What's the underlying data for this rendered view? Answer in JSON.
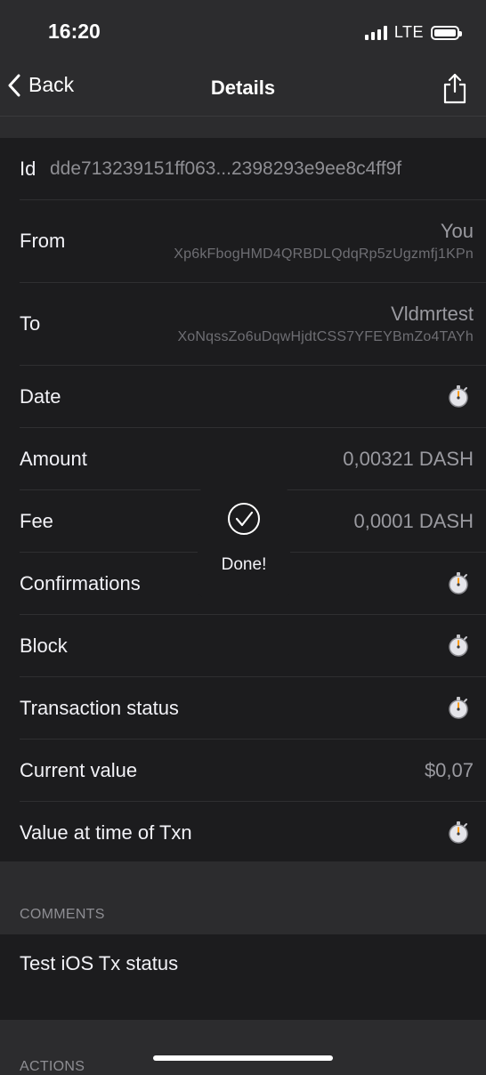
{
  "status_bar": {
    "time": "16:20",
    "network": "LTE"
  },
  "nav": {
    "back_label": "Back",
    "title": "Details"
  },
  "details": {
    "id_label": "Id",
    "id_value": "dde713239151ff063...2398293e9ee8c4ff9f",
    "from_label": "From",
    "from_name": "You",
    "from_address": "Xp6kFbogHMD4QRBDLQdqRp5zUgzmfj1KPn",
    "to_label": "To",
    "to_name": "Vldmrtest",
    "to_address": "XoNqssZo6uDqwHjdtCSS7YFEYBmZo4TAYh",
    "date_label": "Date",
    "amount_label": "Amount",
    "amount_value": "0,00321 DASH",
    "fee_label": "Fee",
    "fee_value": "0,0001 DASH",
    "confirmations_label": "Confirmations",
    "block_label": "Block",
    "tx_status_label": "Transaction status",
    "current_value_label": "Current value",
    "current_value": "$0,07",
    "value_at_time_label": "Value at time of Txn"
  },
  "comments": {
    "header": "COMMENTS",
    "text": "Test iOS Tx status"
  },
  "actions": {
    "header": "ACTIONS"
  },
  "hud": {
    "text": "Done!"
  },
  "icons": {
    "pending": "stopwatch-icon",
    "share": "share-icon",
    "back": "chevron-left-icon",
    "done": "checkmark-circle-icon"
  },
  "colors": {
    "background": "#1c1c1e",
    "grouped_background": "#2c2c2e",
    "secondary_text": "#9a9aa0"
  }
}
